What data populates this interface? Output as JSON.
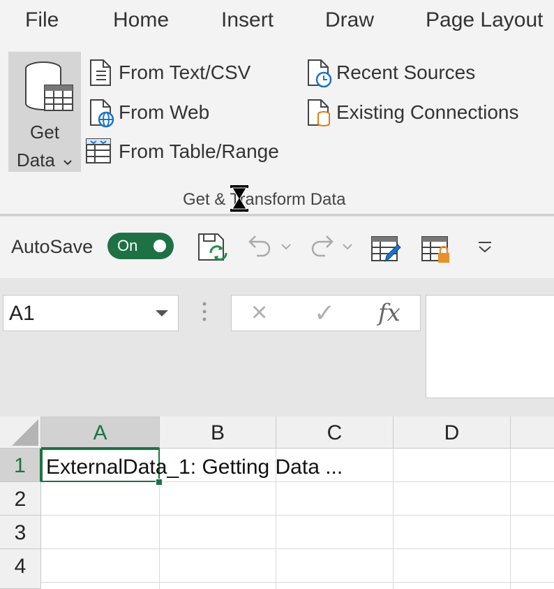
{
  "ribbon": {
    "tabs": [
      "File",
      "Home",
      "Insert",
      "Draw",
      "Page Layout"
    ],
    "get_data": {
      "line1": "Get",
      "line2": "Data",
      "icon": "database-table-icon"
    },
    "commands": [
      {
        "label": "From Text/CSV",
        "icon": "text-file-icon"
      },
      {
        "label": "From Web",
        "icon": "web-file-icon"
      },
      {
        "label": "From Table/Range",
        "icon": "table-range-icon"
      },
      {
        "label": "Recent Sources",
        "icon": "recent-clock-icon"
      },
      {
        "label": "Existing Connections",
        "icon": "connection-cylinder-icon"
      }
    ],
    "group_label": "Get & Transform Data"
  },
  "qat": {
    "autosave_label": "AutoSave",
    "autosave_state": "On",
    "accent": "#1e7145"
  },
  "formula_bar": {
    "name_box": "A1",
    "cancel_icon": "×",
    "enter_icon": "✓",
    "fx": "fx"
  },
  "grid": {
    "columns": [
      "A",
      "B",
      "C",
      "D"
    ],
    "rows": [
      "1",
      "2",
      "3",
      "4"
    ],
    "active_cell": "A1",
    "cells": {
      "A1": "ExternalData_1: Getting Data ..."
    }
  }
}
